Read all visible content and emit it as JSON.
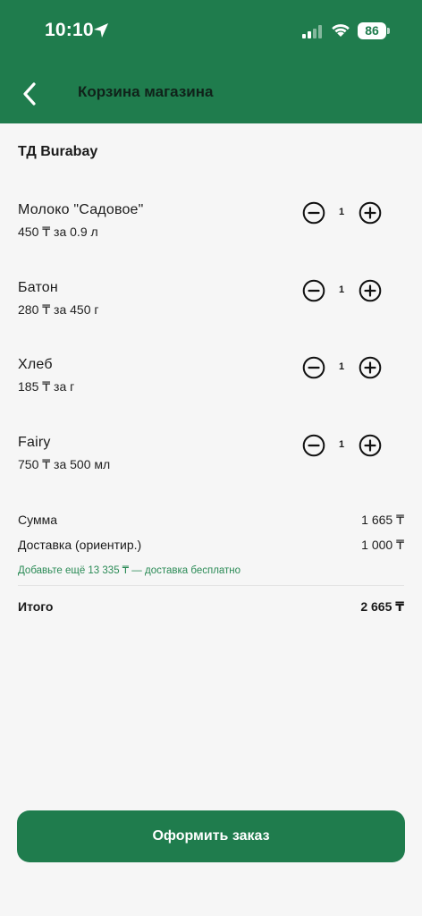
{
  "status_bar": {
    "time": "10:10",
    "battery": "86"
  },
  "header": {
    "title": "Корзина магазина"
  },
  "store": {
    "name": "ТД Burabay"
  },
  "items": [
    {
      "name": "Молоко \"Садовое\"",
      "price": "450 ₸ за 0.9 л",
      "qty": "1"
    },
    {
      "name": "Батон",
      "price": "280 ₸ за 450 г",
      "qty": "1"
    },
    {
      "name": "Хлеб",
      "price": "185 ₸ за г",
      "qty": "1"
    },
    {
      "name": "Fairy",
      "price": "750 ₸ за 500 мл",
      "qty": "1"
    }
  ],
  "summary": {
    "subtotal_label": "Сумма",
    "subtotal_value": "1 665 ₸",
    "delivery_label": "Доставка (ориентир.)",
    "delivery_value": "1 000 ₸",
    "free_delivery_hint": "Добавьте ещё 13 335 ₸ — доставка бесплатно",
    "total_label": "Итого",
    "total_value": "2 665 ₸"
  },
  "checkout": {
    "label": "Оформить заказ"
  },
  "colors": {
    "brand_green": "#1f7c4d",
    "hint_green": "#2a8a55",
    "background": "#f6f6f6"
  },
  "icons": {
    "back": "chevron-left-icon",
    "minus": "minus-circle-icon",
    "plus": "plus-circle-icon",
    "location": "location-arrow-icon",
    "signal": "cellular-signal-icon",
    "wifi": "wifi-icon"
  }
}
